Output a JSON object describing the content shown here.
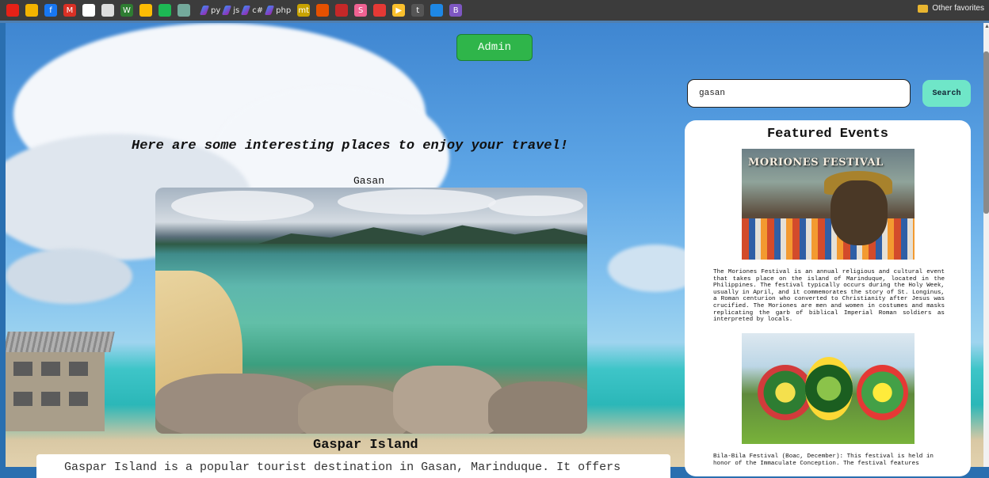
{
  "bookmarks": {
    "items": [
      {
        "icon": "youtube-icon",
        "color": "#e62117",
        "label": ""
      },
      {
        "icon": "google-drive-icon",
        "color": "#f4b400",
        "label": ""
      },
      {
        "icon": "facebook-icon",
        "color": "#1877f2",
        "label": "f"
      },
      {
        "icon": "gmail-icon",
        "color": "#d93025",
        "label": "M"
      },
      {
        "icon": "github-icon",
        "color": "#ffffff",
        "label": ""
      },
      {
        "icon": "bulb-icon",
        "color": "#dddddd",
        "label": ""
      },
      {
        "icon": "w-icon",
        "color": "#2e7d32",
        "label": "W"
      },
      {
        "icon": "photos-icon",
        "color": "#fbbc04",
        "label": ""
      },
      {
        "icon": "spotify-icon",
        "color": "#1db954",
        "label": ""
      },
      {
        "icon": "chatgpt-icon",
        "color": "#74aa9c",
        "label": ""
      }
    ],
    "links": [
      {
        "icon": "py-icon",
        "label": "py"
      },
      {
        "icon": "js-icon",
        "label": "js"
      },
      {
        "icon": "csharp-icon",
        "label": "c#"
      },
      {
        "icon": "php-icon",
        "label": "php"
      }
    ],
    "items2": [
      {
        "icon": "mt-icon",
        "color": "#c8a200",
        "label": "mt"
      },
      {
        "icon": "dots-icon",
        "color": "#e65100",
        "label": ""
      },
      {
        "icon": "arrow-icon",
        "color": "#c62828",
        "label": ""
      },
      {
        "icon": "s-icon",
        "color": "#f06292",
        "label": "S"
      },
      {
        "icon": "chart-icon",
        "color": "#e53935",
        "label": ""
      },
      {
        "icon": "play-icon",
        "color": "#fbc02d",
        "label": "▶"
      },
      {
        "icon": "tumblr-icon",
        "color": "#555555",
        "label": "t"
      },
      {
        "icon": "flag-icon",
        "color": "#1e88e5",
        "label": ""
      },
      {
        "icon": "b-icon",
        "color": "#7e57c2",
        "label": "B"
      }
    ],
    "other_favorites": "Other favorites"
  },
  "header": {
    "admin_label": "Admin"
  },
  "main": {
    "tagline": "Here are some interesting places to enjoy your travel!",
    "place_town": "Gasan",
    "place_title": "Gaspar Island",
    "place_description": "Gaspar Island is a popular tourist destination in Gasan, Marinduque. It offers"
  },
  "search": {
    "value": "gasan",
    "button_label": "Search"
  },
  "events": {
    "title": "Featured Events",
    "image1_title": "MORIONES FESTIVAL",
    "event1_description": "The Moriones Festival is an annual religious and cultural event that takes place on the island of Marinduque, located in the Philippines. The festival typically occurs during the Holy Week, usually in April, and it commemorates the story of St. Longinus, a Roman centurion who converted to Christianity after Jesus was crucified. The Moriones are men and women in costumes and masks replicating the garb of biblical Imperial Roman soldiers as interpreted by locals.",
    "event2_description": "Bila-Bila Festival (Boac, December): This festival is held in honor of the Immaculate Conception. The festival features"
  }
}
